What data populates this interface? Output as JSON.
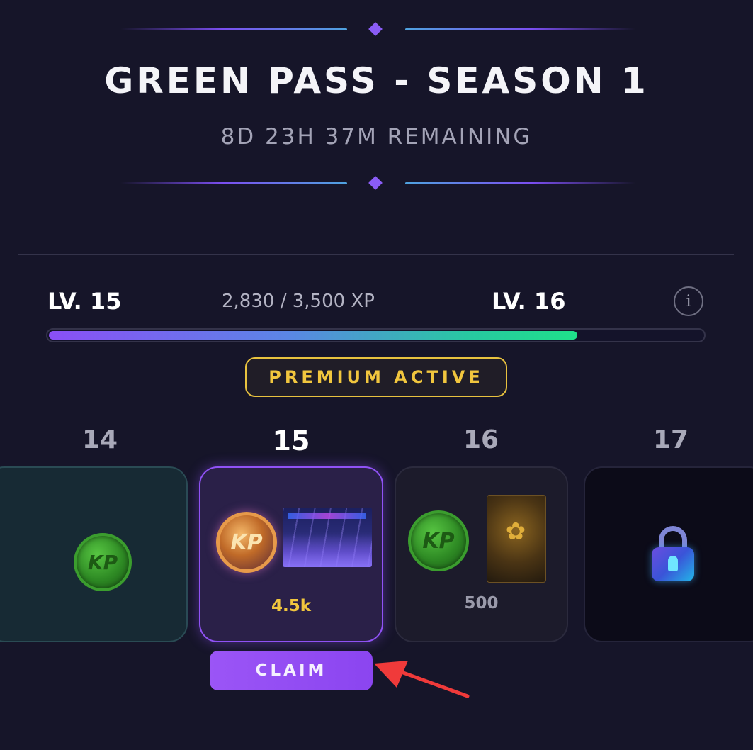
{
  "header": {
    "title": "GREEN PASS - SEASON 1",
    "remaining": "8D 23H 37M REMAINING"
  },
  "progress": {
    "current_level": "LV. 15",
    "next_level": "LV. 16",
    "xp_text": "2,830 / 3,500 XP",
    "xp_current": 2830,
    "xp_required": 3500,
    "info_icon": "info-icon"
  },
  "premium_badge": "PREMIUM ACTIVE",
  "tiers": [
    {
      "number": "14",
      "state": "claimed",
      "rewards": [
        "kp-coin-green"
      ],
      "amount": ""
    },
    {
      "number": "15",
      "state": "claimable",
      "rewards": [
        "kp-coin-gold",
        "arena-image"
      ],
      "amount": "4.5k"
    },
    {
      "number": "16",
      "state": "upcoming",
      "rewards": [
        "kp-coin-green",
        "gold-pack-image"
      ],
      "amount": "500"
    },
    {
      "number": "17",
      "state": "locked",
      "rewards": [
        "lock-icon"
      ],
      "amount": ""
    }
  ],
  "coin_label": "KP",
  "pack_glyph": "✿",
  "claim_button": "CLAIM",
  "colors": {
    "accent_purple": "#8b4ff6",
    "premium_gold": "#f1c63e",
    "progress_end": "#1fe08a",
    "annotation_arrow": "#f03a3a"
  }
}
